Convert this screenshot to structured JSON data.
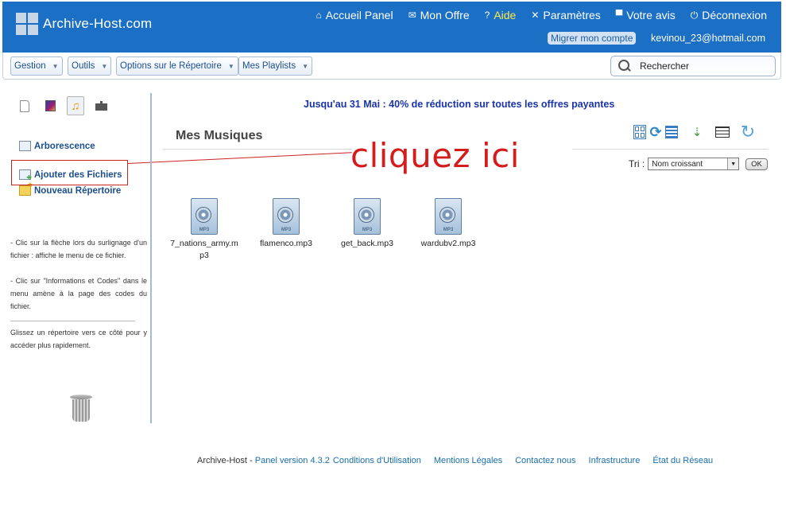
{
  "header": {
    "logo_text": "Archive-Host.com",
    "nav": [
      {
        "label": "Accueil Panel",
        "icon": "home-icon"
      },
      {
        "label": "Mon Offre",
        "icon": "offer-icon"
      },
      {
        "label": "Aide",
        "icon": "help-icon"
      },
      {
        "label": "Paramètres",
        "icon": "tools-icon"
      },
      {
        "label": "Votre avis",
        "icon": "comment-icon"
      },
      {
        "label": "Déconnexion",
        "icon": "power-icon"
      }
    ],
    "migrate_label": "Migrer mon compte",
    "account_email": "kevinou_23@hotmail.com",
    "colors": {
      "bar": "#1b6fc4",
      "aide": "#ffe94d"
    }
  },
  "toolbar": {
    "menus": [
      "Gestion",
      "Outils",
      "Options sur le Répertoire",
      "Mes Playlists"
    ],
    "search_label": "Rechercher"
  },
  "sidebar": {
    "links": {
      "arborescence": "Arborescence",
      "add_files": "Ajouter des Fichiers",
      "new_folder": "Nouveau Répertoire"
    },
    "help": [
      "- Clic sur la flèche lors du surlignage d'un fichier : affiche le menu de ce fichier.",
      "- Clic sur \"Informations et Codes\" dans le menu amène à la page des codes du fichier.",
      "Glissez un répertoire vers ce côté pour y accéder plus rapidement."
    ]
  },
  "annotation": {
    "text": "cliquez ici",
    "color": "#d41c1c"
  },
  "main": {
    "promo": "Jusqu'au 31 Mai : 40% de réduction sur toutes les offres payantes",
    "title": "Mes Musiques",
    "sort_label": "Tri :",
    "sort_value": "Nom croissant",
    "ok_label": "OK",
    "file_badge": "MP3",
    "files": [
      {
        "name": "7_nations_army.mp3"
      },
      {
        "name": "flamenco.mp3"
      },
      {
        "name": "get_back.mp3"
      },
      {
        "name": "wardubv2.mp3"
      }
    ]
  },
  "footer": {
    "brand": "Archive-Host -",
    "links": [
      "Panel version 4.3.2",
      "Conditions d'Utilisation",
      "Mentions Légales",
      "Contactez nous",
      "Infrastructure",
      "État du Réseau"
    ]
  }
}
